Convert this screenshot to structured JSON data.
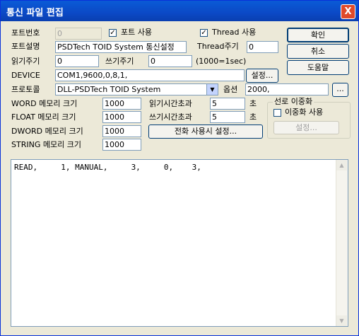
{
  "window": {
    "title": "통신 파일 편집",
    "close_label": "X"
  },
  "port_no": {
    "label": "포트번호",
    "value": "0"
  },
  "port_use": {
    "label": "포트 사용",
    "checked": "✓"
  },
  "thread_use": {
    "label": "Thread 사용",
    "checked": "✓"
  },
  "port_desc": {
    "label": "포트설명",
    "value": "PSDTech TOID System 통신설정"
  },
  "thread_period": {
    "label": "Thread주기",
    "value": "0"
  },
  "read_period": {
    "label": "읽기주기",
    "value": "0"
  },
  "write_period": {
    "label": "쓰기주기",
    "value": "0"
  },
  "period_unit": "(1000=1sec)",
  "device": {
    "label": "DEVICE",
    "value": "COM1,9600,0,8,1,",
    "button": "설정..."
  },
  "protocol": {
    "label": "프로토콜",
    "value": "DLL-PSDTech TOID System"
  },
  "option": {
    "label": "옵션",
    "value": "2000,",
    "button": "..."
  },
  "memory": {
    "word": {
      "label": "WORD 메모리 크기",
      "value": "1000"
    },
    "float": {
      "label": "FLOAT 메모리 크기",
      "value": "1000"
    },
    "dword": {
      "label": "DWORD 메모리 크기",
      "value": "1000"
    },
    "string": {
      "label": "STRING 메모리 크기",
      "value": "1000"
    }
  },
  "timeouts": {
    "read": {
      "label": "읽기시간초과",
      "value": "5",
      "unit": "초"
    },
    "write": {
      "label": "쓰기시간초과",
      "value": "5",
      "unit": "초"
    }
  },
  "phone_button": "전화 사용시 설정...",
  "redundancy": {
    "group_label": "선로 이중화",
    "check_label": "이중화 사용",
    "settings_button": "설정..."
  },
  "buttons": {
    "ok": "확인",
    "cancel": "취소",
    "help": "도움말"
  },
  "editor_text": "READ,     1, MANUAL,     3,     0,    3,"
}
